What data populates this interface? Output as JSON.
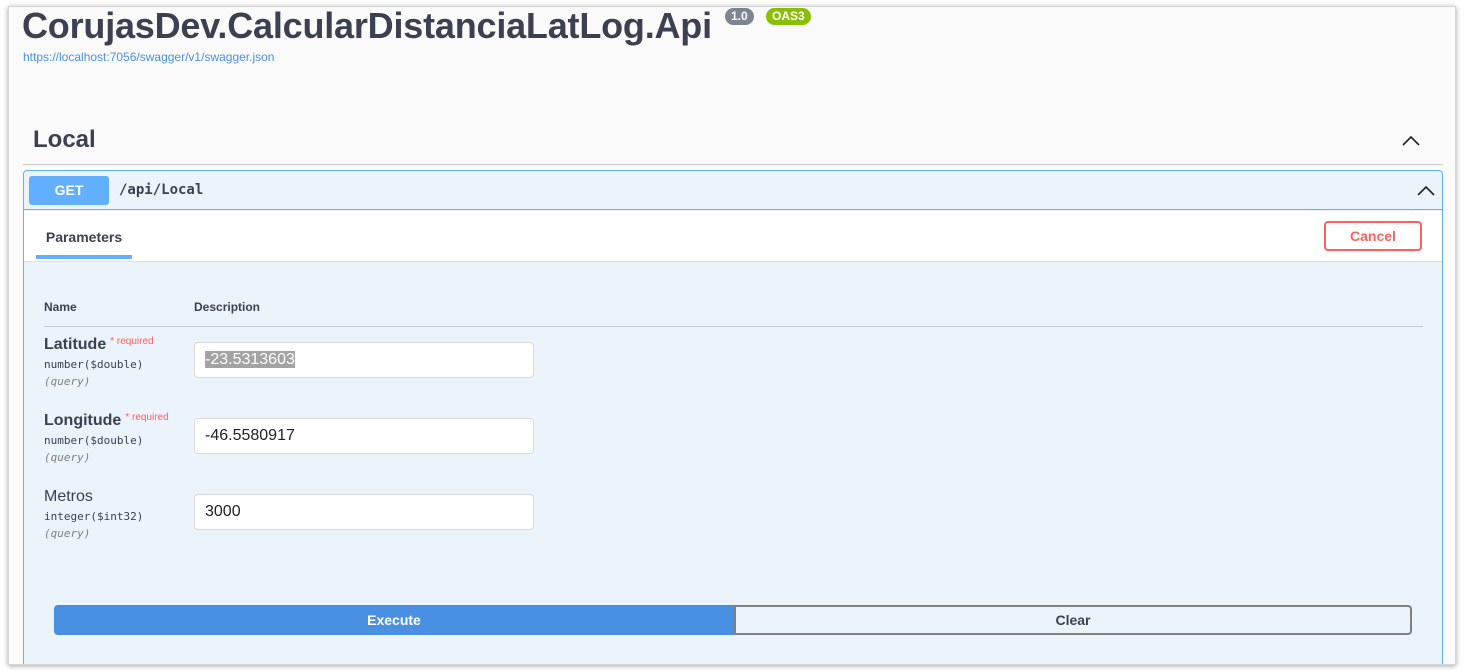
{
  "header": {
    "title": "CorujasDev.CalcularDistanciaLatLog.Api",
    "version_badge": "1.0",
    "oas_badge": "OAS3",
    "spec_url": "https://localhost:7056/swagger/v1/swagger.json"
  },
  "tag": {
    "name": "Local",
    "chevron_icon": "chevron-up-icon"
  },
  "operation": {
    "method": "GET",
    "path": "/api/Local",
    "chevron_icon": "chevron-up-icon",
    "tab_label": "Parameters",
    "cancel_label": "Cancel",
    "columns": {
      "name": "Name",
      "description": "Description"
    },
    "params": [
      {
        "name": "Latitude",
        "required_label": "* required",
        "type": "number($double)",
        "location": "(query)",
        "value": "-23.5313603"
      },
      {
        "name": "Longitude",
        "required_label": "* required",
        "type": "number($double)",
        "location": "(query)",
        "value": "-46.5580917"
      },
      {
        "name": "Metros",
        "type": "integer($int32)",
        "location": "(query)",
        "value": "3000"
      }
    ],
    "execute_label": "Execute",
    "clear_label": "Clear"
  },
  "colors": {
    "get_accent": "#61affe",
    "execute": "#4990e2",
    "cancel": "#ff6060",
    "oas_badge": "#89bf04",
    "version_badge": "#7d8492"
  }
}
